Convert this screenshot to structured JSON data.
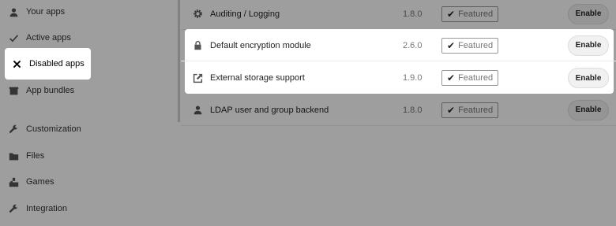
{
  "sidebar": {
    "items": [
      {
        "label": "Your apps",
        "icon": "user-icon"
      },
      {
        "label": "Active apps",
        "icon": "check-icon"
      },
      {
        "label": "Disabled apps",
        "icon": "close-icon"
      },
      {
        "label": "App bundles",
        "icon": "bundle-icon"
      },
      {
        "label": "Customization",
        "icon": "wrench-icon"
      },
      {
        "label": "Files",
        "icon": "folder-icon"
      },
      {
        "label": "Games",
        "icon": "games-icon"
      },
      {
        "label": "Integration",
        "icon": "wrench-icon"
      }
    ],
    "active_item": "Disabled apps"
  },
  "apps": [
    {
      "name": "Auditing / Logging",
      "version": "1.8.0",
      "badge": "Featured",
      "button": "Enable",
      "icon": "gear-icon"
    },
    {
      "name": "Default encryption module",
      "version": "2.6.0",
      "badge": "Featured",
      "button": "Enable",
      "icon": "lock-icon"
    },
    {
      "name": "External storage support",
      "version": "1.9.0",
      "badge": "Featured",
      "button": "Enable",
      "icon": "external-link-icon"
    },
    {
      "name": "LDAP user and group backend",
      "version": "1.8.0",
      "badge": "Featured",
      "button": "Enable",
      "icon": "user-icon"
    }
  ]
}
